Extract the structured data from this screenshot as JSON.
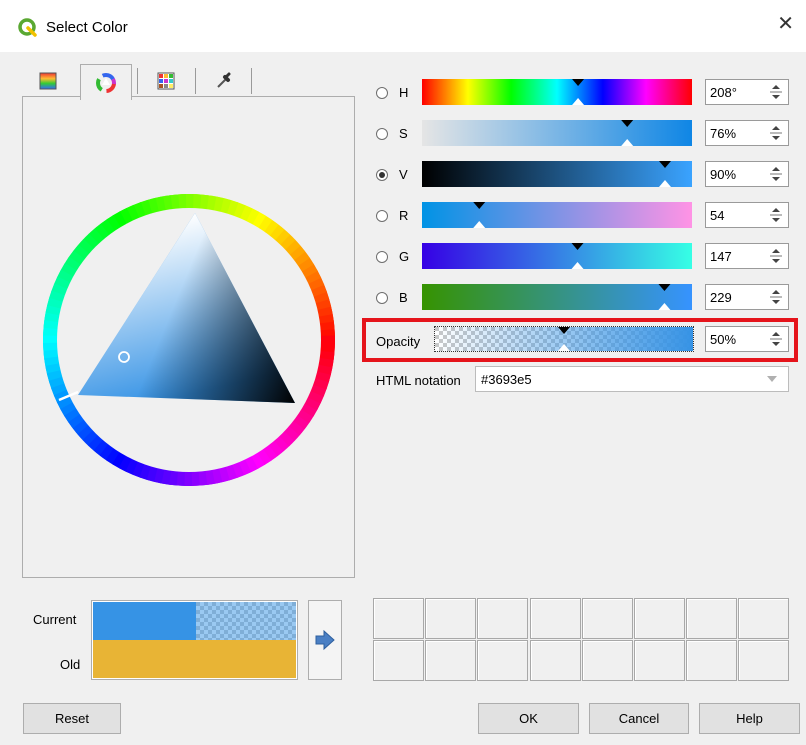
{
  "window": {
    "title": "Select Color"
  },
  "tabs": [
    {
      "name": "color-ramp-tab"
    },
    {
      "name": "color-wheel-tab",
      "active": true
    },
    {
      "name": "swatches-tab"
    },
    {
      "name": "color-picker-tab"
    }
  ],
  "channels": [
    {
      "key": "H",
      "label": "H",
      "value": "208°",
      "checked": false,
      "marker_fraction": 0.578
    },
    {
      "key": "S",
      "label": "S",
      "value": "76%",
      "checked": false,
      "marker_fraction": 0.76
    },
    {
      "key": "V",
      "label": "V",
      "value": "90%",
      "checked": true,
      "marker_fraction": 0.9
    },
    {
      "key": "R",
      "label": "R",
      "value": "54",
      "checked": false,
      "marker_fraction": 0.212
    },
    {
      "key": "G",
      "label": "G",
      "value": "147",
      "checked": false,
      "marker_fraction": 0.576
    },
    {
      "key": "B",
      "label": "B",
      "value": "229",
      "checked": false,
      "marker_fraction": 0.898
    }
  ],
  "opacity": {
    "label": "Opacity",
    "value": "50%",
    "fraction": 0.5
  },
  "html_notation": {
    "label": "HTML notation",
    "value": "#3693e5"
  },
  "preview": {
    "current_label": "Current",
    "old_label": "Old"
  },
  "buttons": {
    "reset": "Reset",
    "ok": "OK",
    "cancel": "Cancel",
    "help": "Help"
  },
  "colors": {
    "current": "#3693e5",
    "old": "#e8b435",
    "highlight": "#e5141b"
  }
}
